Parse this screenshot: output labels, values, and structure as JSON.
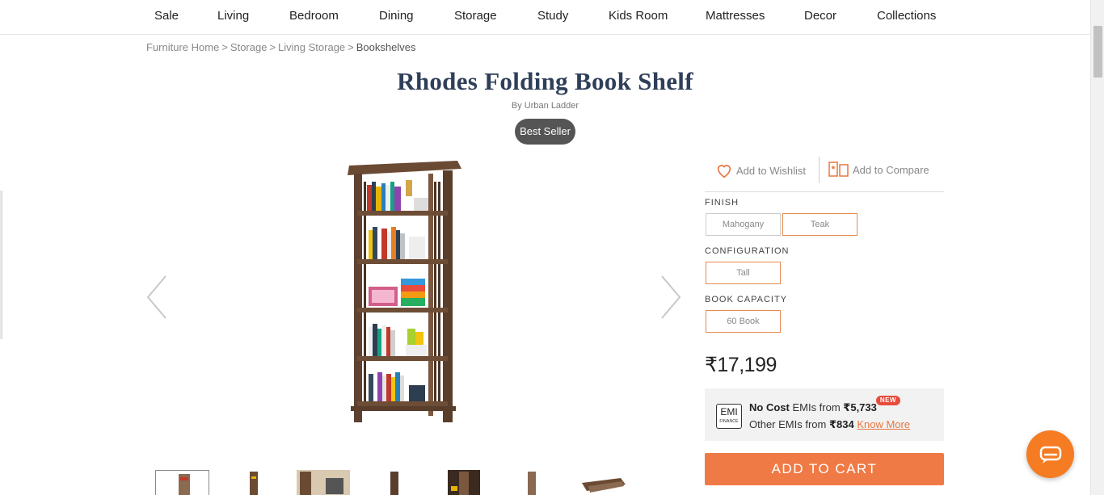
{
  "nav": {
    "items": [
      "Sale",
      "Living",
      "Bedroom",
      "Dining",
      "Storage",
      "Study",
      "Kids Room",
      "Mattresses",
      "Decor",
      "Collections"
    ]
  },
  "breadcrumb": [
    "Furniture Home",
    "Storage",
    "Living Storage",
    "Bookshelves"
  ],
  "breadcrumb_separator": ">",
  "product": {
    "title": "Rhodes Folding Book Shelf",
    "brand": "By Urban Ladder",
    "badge": "Best Seller",
    "price": "₹17,199"
  },
  "actions": {
    "wishlist": "Add to Wishlist",
    "compare": "Add to Compare"
  },
  "options": {
    "finish_label": "FINISH",
    "finish": [
      {
        "label": "Mahogany",
        "selected": false
      },
      {
        "label": "Teak",
        "selected": true
      }
    ],
    "configuration_label": "CONFIGURATION",
    "configuration": [
      {
        "label": "Tall",
        "selected": true
      }
    ],
    "capacity_label": "BOOK CAPACITY",
    "capacity": [
      {
        "label": "60 Book",
        "selected": true
      }
    ]
  },
  "emi": {
    "icon_text": "EMI",
    "icon_sub": "FINANCE",
    "line1_bold": "No Cost",
    "line1_text": " EMIs from ",
    "line1_amount": "₹5,733",
    "new_badge": "NEW",
    "line2_text": "Other EMIs from ",
    "line2_amount": "₹834",
    "know_more": "Know More"
  },
  "cart": {
    "label": "ADD TO CART"
  },
  "colors": {
    "accent": "#ef7a45",
    "title": "#2f3f5a",
    "badge_bg": "#555555",
    "chat": "#f57c22"
  }
}
